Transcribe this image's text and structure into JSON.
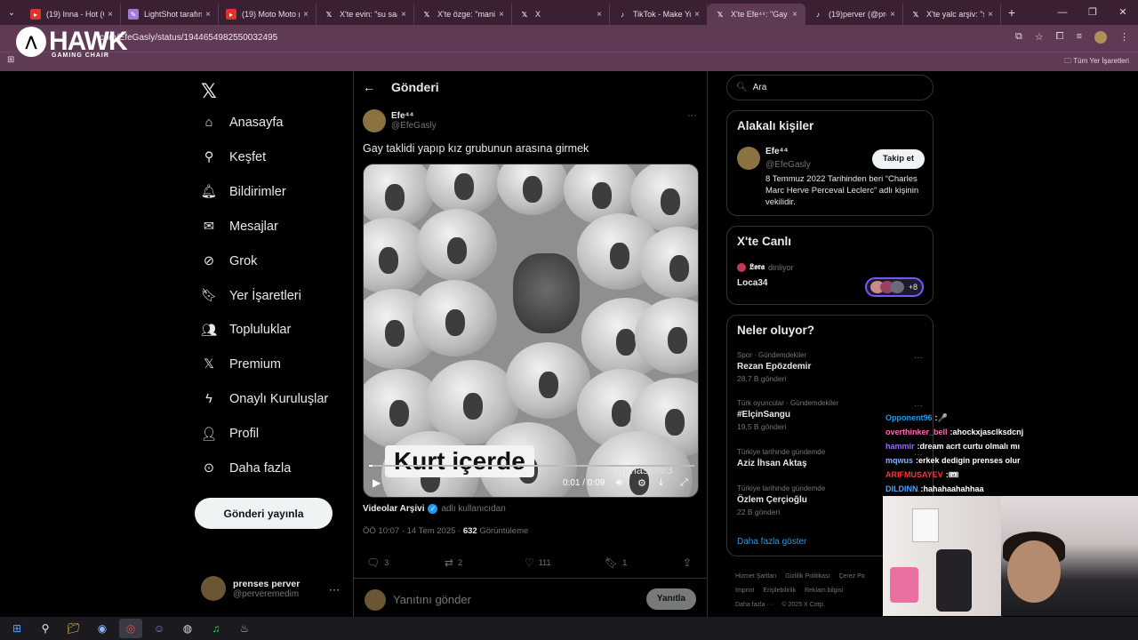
{
  "browser": {
    "tabs": [
      {
        "title": "(19) Inna - Hot (O",
        "icon": "youtube-icon",
        "color": "#e0312d"
      },
      {
        "title": "LightShot tarafınd",
        "icon": "lightshot-icon",
        "color": "#a07cd6"
      },
      {
        "title": "(19) Moto Moto (",
        "icon": "youtube-icon",
        "color": "#e0312d"
      },
      {
        "title": "X'te evin: \"su saat",
        "icon": "x-icon",
        "color": "#000000"
      },
      {
        "title": "X'te özge: \"manife",
        "icon": "x-icon",
        "color": "#000000"
      },
      {
        "title": "X",
        "icon": "x-icon",
        "color": "#000000"
      },
      {
        "title": "TikTok - Make You",
        "icon": "tiktok-icon",
        "color": "#000000"
      },
      {
        "title": "X'te Efe⁴⁴: \"Gay ta",
        "icon": "x-icon",
        "color": "#000000",
        "active": true
      },
      {
        "title": "(19)perver (@pre",
        "icon": "tiktok-icon",
        "color": "#000000"
      },
      {
        "title": "X'te yalc arşiv: \"si",
        "icon": "x-icon",
        "color": "#000000"
      }
    ],
    "url": "com/EfeGasly/status/1944654982550032495",
    "bookmarks_all": "Tüm Yer İşaretleri",
    "overlay_brand": "HAWK",
    "overlay_sub": "GAMING CHAIR"
  },
  "nav": {
    "items": [
      {
        "label": "Anasayfa",
        "icon": "home-icon"
      },
      {
        "label": "Keşfet",
        "icon": "search-icon"
      },
      {
        "label": "Bildirimler",
        "icon": "bell-icon"
      },
      {
        "label": "Mesajlar",
        "icon": "mail-icon"
      },
      {
        "label": "Grok",
        "icon": "grok-icon"
      },
      {
        "label": "Yer İşaretleri",
        "icon": "bookmark-icon"
      },
      {
        "label": "Topluluklar",
        "icon": "communities-icon"
      },
      {
        "label": "Premium",
        "icon": "x-icon"
      },
      {
        "label": "Onaylı Kuruluşlar",
        "icon": "lightning-icon"
      },
      {
        "label": "Profil",
        "icon": "person-icon"
      },
      {
        "label": "Daha fazla",
        "icon": "more-circle-icon"
      }
    ],
    "post_button": "Gönderi yayınla",
    "account": {
      "name": "prenses perver",
      "handle": "@perveremedim"
    }
  },
  "post": {
    "header": "Gönderi",
    "author_name": "Efe⁴⁴",
    "author_handle": "@EfeGasly",
    "text": "Gay taklidi yapıp kız grubunun arasına girmek",
    "video": {
      "caption": "Kurt içerde",
      "watermark": "mmaskse3",
      "time": "0:01 / 0:09",
      "progress_fraction": 0.01
    },
    "source_name": "Videolar Arşivi",
    "source_suffix": "adlı kullanıcıdan",
    "timestamp": "ÖÖ 10:07 · 14 Tem 2025 ·",
    "views": "632",
    "views_label": "Görüntüleme",
    "counts": {
      "replies": "3",
      "reposts": "2",
      "likes": "111",
      "bookmarks": "1"
    },
    "reply_placeholder": "Yanıtını gönder",
    "reply_button": "Yanıtla"
  },
  "sidebar": {
    "search_placeholder": "Ara",
    "related": {
      "title": "Alakalı kişiler",
      "name": "Efe⁴⁴",
      "handle": "@EfeGasly",
      "follow": "Takip et",
      "bio": "8 Temmuz 2022 Tarihinden beri “Charles Marc Herve Perceval Leclerc” adlı kişinin vekilidir."
    },
    "live": {
      "title": "X'te Canlı",
      "host": "𝕷𝖔𝖗𝖆",
      "listening": "dinliyor",
      "name": "Loca34",
      "extra": "+8"
    },
    "trends": {
      "title": "Neler oluyor?",
      "items": [
        {
          "context": "Spor · Gündemdekiler",
          "topic": "Rezan Epözdemir",
          "count": "28,7 B gönderi"
        },
        {
          "context": "Türk oyuncular · Gündemdekiler",
          "topic": "#ElçinSangu",
          "count": "19,5 B gönderi"
        },
        {
          "context": "Türkiye tarihinde gündemde",
          "topic": "Aziz İhsan Aktaş",
          "count": ""
        },
        {
          "context": "Türkiye tarihinde gündemde",
          "topic": "Özlem Çerçioğlu",
          "count": "22 B gönderi"
        }
      ],
      "show_more": "Daha fazla göster"
    },
    "footer": [
      "Hizmet Şartları",
      "Gizlilik Politikası",
      "Çerez Po",
      "Imprint",
      "Erişilebilirlik",
      "Reklam bilgisi",
      "Daha fazla ···",
      "© 2025 X Corp."
    ]
  },
  "stream_chat": [
    {
      "user": "Opponent96",
      "msg": "🎤",
      "color": "#1d9bf0"
    },
    {
      "user": "overthinker_bell",
      "msg": "ahockxjasclksdcnj",
      "color": "#ff69b4"
    },
    {
      "user": "hammir",
      "msg": "dream acrt curtu olmalı mı",
      "color": "#9b6bff"
    },
    {
      "user": "mqwus",
      "msg": "erkek dedigin prenses olur",
      "color": "#7fb2ff"
    },
    {
      "user": "ARIFMUSAYEV",
      "msg": "🎟",
      "color": "#ff3333"
    },
    {
      "user": "DILDINN",
      "msg": "hahahaahahhaa",
      "color": "#4aa3ff"
    }
  ],
  "taskbar": [
    "windows-icon",
    "search-icon",
    "files-icon",
    "app-icon",
    "chrome-icon",
    "discord-icon",
    "obs-icon",
    "spotify-icon",
    "steam-icon"
  ]
}
